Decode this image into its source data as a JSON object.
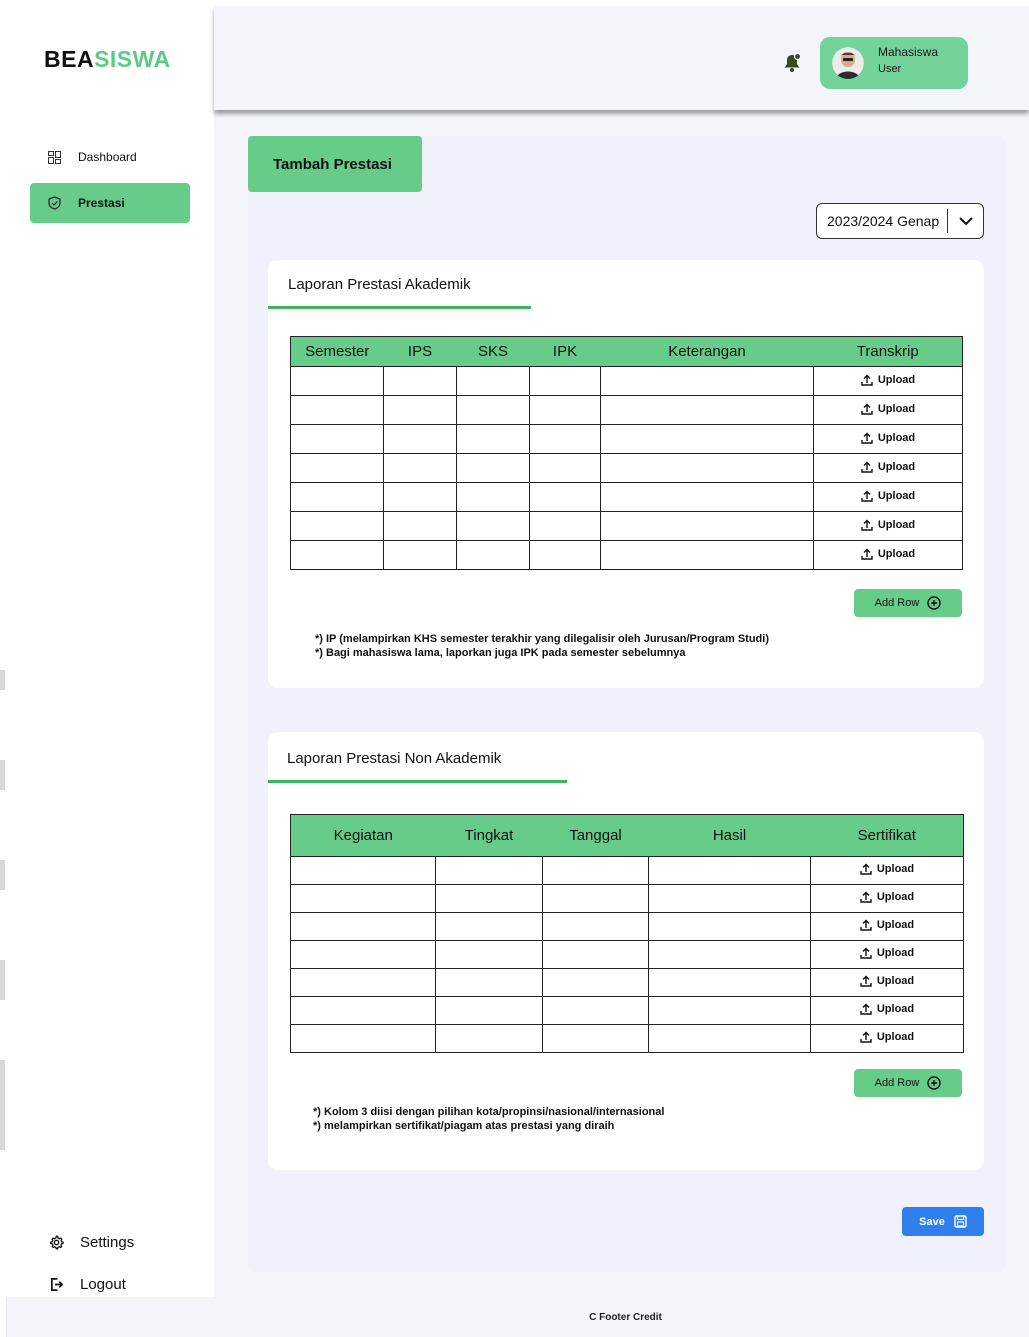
{
  "app": {
    "logo_part1": "BEA",
    "logo_part2": "SISWA"
  },
  "sidebar": {
    "items": [
      {
        "label": "Dashboard",
        "icon": "grid-icon"
      },
      {
        "label": "Prestasi",
        "icon": "shield-check-icon",
        "active": true
      }
    ],
    "bottom": [
      {
        "label": "Settings",
        "icon": "gear-icon"
      },
      {
        "label": "Logout",
        "icon": "logout-icon"
      }
    ]
  },
  "header": {
    "user_name": "Mahasiswa",
    "user_role": "User",
    "bell_icon": "bell-icon"
  },
  "page": {
    "tab_label": "Tambah Prestasi",
    "period_value": "2023/2024 Genap",
    "save_label": "Save"
  },
  "akademik": {
    "title": "Laporan Prestasi Akademik",
    "columns": [
      "Semester",
      "IPS",
      "SKS",
      "IPK",
      "Keterangan",
      "Transkrip"
    ],
    "upload_label": "Upload",
    "row_count": 7,
    "add_row_label": "Add Row",
    "notes": [
      "*) IP (melampirkan KHS semester terakhir yang dilegalisir oleh Jurusan/Program Studi)",
      "*) Bagi mahasiswa lama, laporkan juga IPK pada semester sebelumnya"
    ]
  },
  "nonakademik": {
    "title": "Laporan Prestasi Non Akademik",
    "columns": [
      "Kegiatan",
      "Tingkat",
      "Tanggal",
      "Hasil",
      "Sertifikat"
    ],
    "upload_label": "Upload",
    "row_count": 7,
    "add_row_label": "Add Row",
    "notes": [
      "*) Kolom 3 diisi dengan pilihan kota/propinsi/nasional/internasional",
      "*) melampirkan sertifikat/piagam atas prestasi yang diraih"
    ]
  },
  "footer": {
    "credit": "C Footer Credit"
  },
  "colors": {
    "accent_green": "#67cc89",
    "save_blue": "#2f80ed",
    "underline_green": "#3fb45f"
  }
}
